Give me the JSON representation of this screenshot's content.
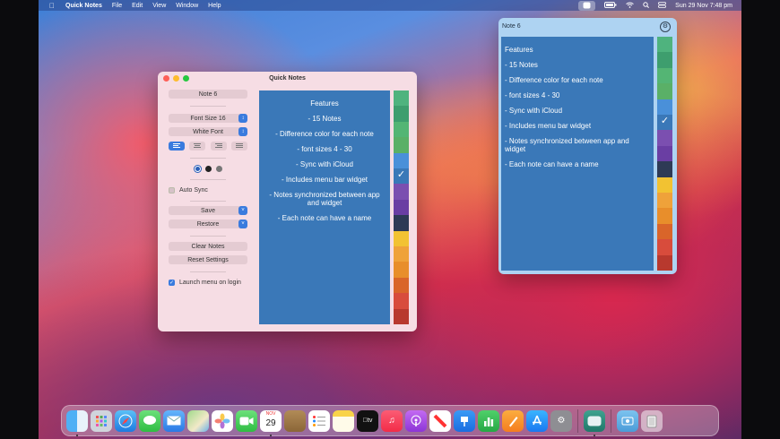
{
  "menubar": {
    "app_name": "Quick Notes",
    "menus": [
      "File",
      "Edit",
      "View",
      "Window",
      "Help"
    ],
    "clock": "Sun 29 Nov  7:48 pm"
  },
  "window": {
    "title": "Quick Notes",
    "note_name": "Note 6",
    "font_size": "Font Size 16",
    "font_color": "White Font",
    "auto_sync_label": "Auto Sync",
    "save_label": "Save",
    "restore_label": "Restore",
    "clear_label": "Clear Notes",
    "reset_label": "Reset Settings",
    "launch_label": "Launch menu on login"
  },
  "note": {
    "lines": [
      "Features",
      "- 15 Notes",
      "- Difference color for each note",
      "- font sizes 4 - 30",
      "- Sync with iCloud",
      "- Includes menu bar widget",
      "- Notes synchronized between app and widget",
      "- Each note can have a name"
    ]
  },
  "popover": {
    "title": "Note 6"
  },
  "colors": {
    "swatches": [
      "#4fb37e",
      "#3e9e6e",
      "#54b574",
      "#5ab067",
      "#4a90d9",
      "#3a78b8",
      "#7b4fb0",
      "#6a3ea3",
      "#2e3a55",
      "#f2c232",
      "#efa23a",
      "#e88e2b",
      "#d9652a",
      "#d84c3c",
      "#b8392e"
    ],
    "selected_index": 5,
    "note_bg": "#3a78b8",
    "accent": "#3a7bde"
  },
  "dock": {
    "calendar_month": "NOV",
    "calendar_day": "29",
    "apps": [
      "finder-icon",
      "launchpad-icon",
      "safari-icon",
      "messages-icon",
      "mail-icon",
      "maps-icon",
      "photos-icon",
      "facetime-icon",
      "calendar-icon",
      "notes-brown-icon",
      "reminders-icon",
      "notes-icon",
      "apple-tv-icon",
      "music-icon",
      "podcasts-icon",
      "news-icon",
      "keynote-icon",
      "numbers-icon",
      "pages-icon",
      "app-store-icon",
      "system-preferences-icon",
      "quick-notes-icon",
      "downloads-folder-icon",
      "trash-icon"
    ]
  }
}
